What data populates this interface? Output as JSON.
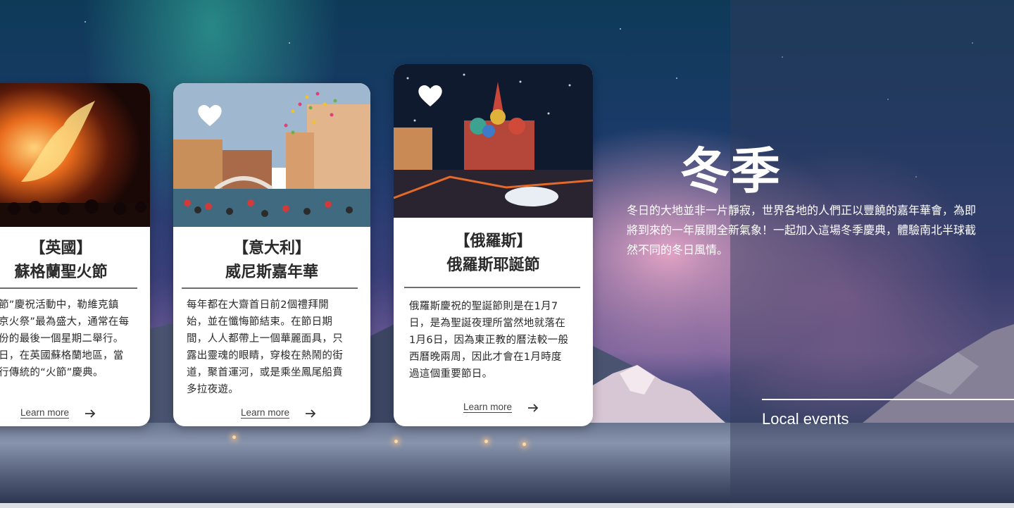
{
  "season": {
    "title": "冬季",
    "intro": "冬日的大地並非一片靜寂，世界各地的人們正以豐饒的嘉年華會，為即將到來的一年展開全新氣象！一起加入這場冬季慶典，體驗南北半球截然不同的冬日風情。"
  },
  "local_events_label": "Local events",
  "cards": [
    {
      "title_line1": "【英國】",
      "title_line2": "蘇格蘭聖火節",
      "desc": "節”慶祝活動中，勒維克鎮京火祭”最為盛大，通常在每份的最後一個星期二舉行。日，在英國蘇格蘭地區，當行傳統的“火節”慶典。",
      "desc_lines": [
        "節”慶祝活動中，勒維克鎮",
        "京火祭”最為盛大，通常在每",
        "份的最後一個星期二舉行。",
        "日，在英國蘇格蘭地區，當",
        "行傳統的“火節”慶典。"
      ],
      "learn_more": "Learn more",
      "icon": "heart-icon"
    },
    {
      "title_line1": "【意大利】",
      "title_line2": "威尼斯嘉年華",
      "desc_lines": [
        "每年都在大齋首日前2個禮拜開",
        "始，並在懺悔節結束。在節日期",
        "間，人人都帶上一個華麗面具，只",
        "露出靈魂的眼睛，穿梭在熱鬧的街",
        "道，聚首運河，或是乘坐鳳尾船賁",
        "多拉夜遊。"
      ],
      "learn_more": "Learn more",
      "icon": "heart-icon"
    },
    {
      "title_line1": "【俄羅斯】",
      "title_line2": "俄羅斯耶誕節",
      "desc_lines": [
        "俄羅斯慶祝的聖誕節則是在1月7",
        "日，是為聖誕夜理所當然地就落在",
        "1月6日，因為東正教的曆法較一般",
        "西曆晚兩周，因此才會在1月時度",
        "過這個重要節日。"
      ],
      "learn_more": "Learn more",
      "icon": "heart-icon"
    }
  ],
  "colors": {
    "card_bg": "#ffffff",
    "text_dark": "#2a2a2a",
    "accent_white": "#ffffff"
  }
}
